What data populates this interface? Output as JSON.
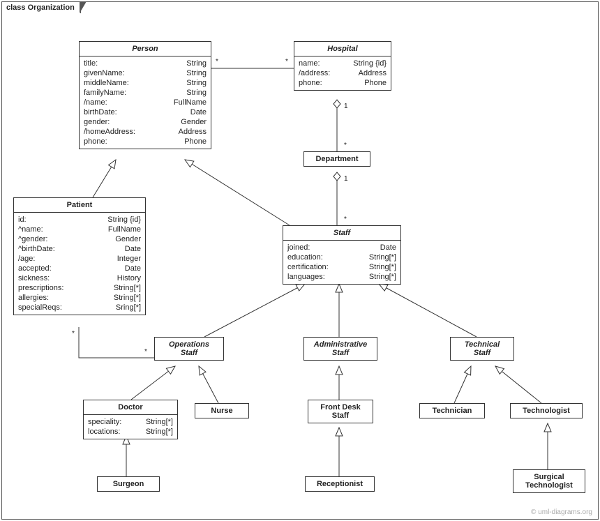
{
  "frameTitle": "class Organization",
  "credit": "© uml-diagrams.org",
  "classes": {
    "person": {
      "name": "Person",
      "attrs": [
        {
          "n": "title:",
          "t": "String"
        },
        {
          "n": "givenName:",
          "t": "String"
        },
        {
          "n": "middleName:",
          "t": "String"
        },
        {
          "n": "familyName:",
          "t": "String"
        },
        {
          "n": "/name:",
          "t": "FullName"
        },
        {
          "n": "birthDate:",
          "t": "Date"
        },
        {
          "n": "gender:",
          "t": "Gender"
        },
        {
          "n": "/homeAddress:",
          "t": "Address"
        },
        {
          "n": "phone:",
          "t": "Phone"
        }
      ]
    },
    "hospital": {
      "name": "Hospital",
      "attrs": [
        {
          "n": "name:",
          "t": "String {id}"
        },
        {
          "n": "/address:",
          "t": "Address"
        },
        {
          "n": "phone:",
          "t": "Phone"
        }
      ]
    },
    "department": {
      "name": "Department"
    },
    "patient": {
      "name": "Patient",
      "attrs": [
        {
          "n": "id:",
          "t": "String {id}"
        },
        {
          "n": "^name:",
          "t": "FullName"
        },
        {
          "n": "^gender:",
          "t": "Gender"
        },
        {
          "n": "^birthDate:",
          "t": "Date"
        },
        {
          "n": "/age:",
          "t": "Integer"
        },
        {
          "n": "accepted:",
          "t": "Date"
        },
        {
          "n": "sickness:",
          "t": "History"
        },
        {
          "n": "prescriptions:",
          "t": "String[*]"
        },
        {
          "n": "allergies:",
          "t": "String[*]"
        },
        {
          "n": "specialReqs:",
          "t": "Sring[*]"
        }
      ]
    },
    "staff": {
      "name": "Staff",
      "attrs": [
        {
          "n": "joined:",
          "t": "Date"
        },
        {
          "n": "education:",
          "t": "String[*]"
        },
        {
          "n": "certification:",
          "t": "String[*]"
        },
        {
          "n": "languages:",
          "t": "String[*]"
        }
      ]
    },
    "opsStaff": {
      "name": "Operations\nStaff"
    },
    "adminStaff": {
      "name": "Administrative\nStaff"
    },
    "techStaff": {
      "name": "Technical\nStaff"
    },
    "doctor": {
      "name": "Doctor",
      "attrs": [
        {
          "n": "speciality:",
          "t": "String[*]"
        },
        {
          "n": "locations:",
          "t": "String[*]"
        }
      ]
    },
    "nurse": {
      "name": "Nurse"
    },
    "frontDesk": {
      "name": "Front Desk\nStaff"
    },
    "technician": {
      "name": "Technician"
    },
    "technologist": {
      "name": "Technologist"
    },
    "surgeon": {
      "name": "Surgeon"
    },
    "receptionist": {
      "name": "Receptionist"
    },
    "surgTech": {
      "name": "Surgical\nTechnologist"
    }
  },
  "mults": {
    "personHospL": "*",
    "personHospR": "*",
    "hospDept1": "1",
    "hospDeptS": "*",
    "deptStaff1": "1",
    "deptStaffS": "*",
    "patOpsP": "*",
    "patOpsO": "*"
  }
}
